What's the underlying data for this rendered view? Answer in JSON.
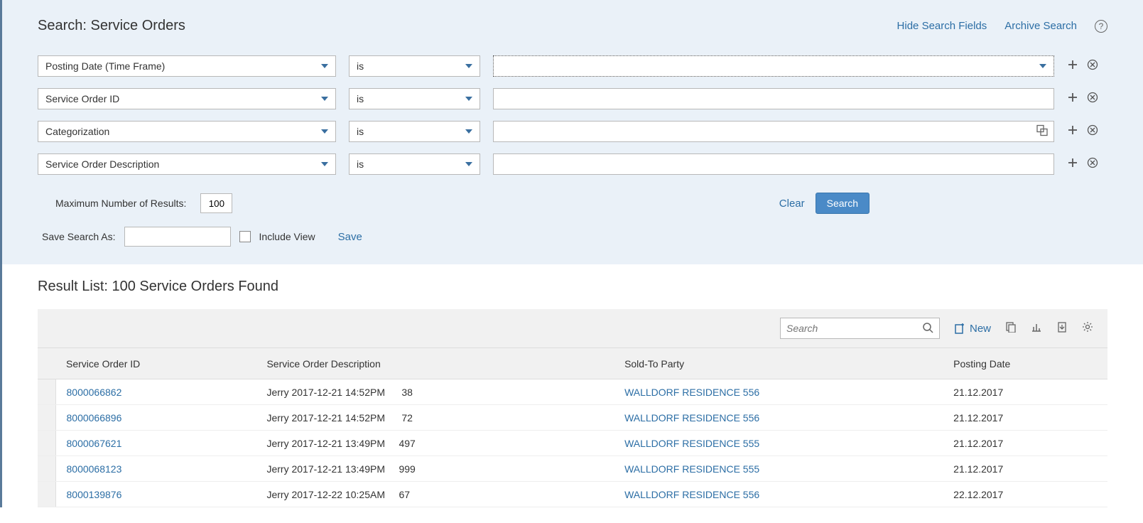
{
  "header": {
    "title": "Search: Service Orders",
    "hide_link": "Hide Search Fields",
    "archive_link": "Archive Search"
  },
  "criteria": {
    "rows": [
      {
        "field": "Posting Date (Time Frame)",
        "op": "is",
        "val_type": "select-dotted"
      },
      {
        "field": "Service Order ID",
        "op": "is",
        "val_type": "input"
      },
      {
        "field": "Categorization",
        "op": "is",
        "val_type": "input-help"
      },
      {
        "field": "Service Order Description",
        "op": "is",
        "val_type": "input"
      }
    ]
  },
  "footer": {
    "max_label": "Maximum Number of Results:",
    "max_value": "100",
    "clear": "Clear",
    "search": "Search",
    "save_as_label": "Save Search As:",
    "include_view": "Include View",
    "save": "Save"
  },
  "results": {
    "title": "Result List: 100 Service Orders Found",
    "search_placeholder": "Search",
    "new_label": "New",
    "columns": [
      "Service Order ID",
      "Service Order Description",
      "Sold-To Party",
      "Posting Date"
    ],
    "rows": [
      {
        "id": "8000066862",
        "desc": "Jerry 2017-12-21 14:52PM      38",
        "party": "WALLDORF RESIDENCE 556",
        "date": "21.12.2017"
      },
      {
        "id": "8000066896",
        "desc": "Jerry 2017-12-21 14:52PM      72",
        "party": "WALLDORF RESIDENCE 556",
        "date": "21.12.2017"
      },
      {
        "id": "8000067621",
        "desc": "Jerry 2017-12-21 13:49PM     497",
        "party": "WALLDORF RESIDENCE 555",
        "date": "21.12.2017"
      },
      {
        "id": "8000068123",
        "desc": "Jerry 2017-12-21 13:49PM     999",
        "party": "WALLDORF RESIDENCE 555",
        "date": "21.12.2017"
      },
      {
        "id": "8000139876",
        "desc": "Jerry 2017-12-22 10:25AM     67",
        "party": "WALLDORF RESIDENCE 556",
        "date": "22.12.2017"
      }
    ]
  }
}
